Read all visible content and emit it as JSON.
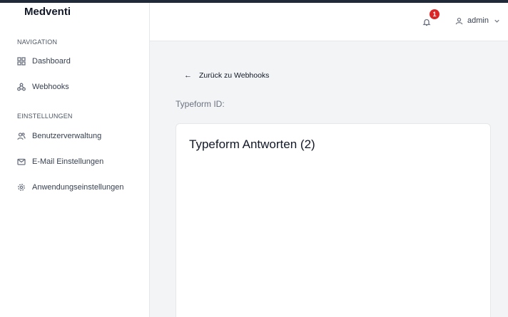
{
  "app": {
    "brand": "Medventi"
  },
  "sidebar": {
    "sections": [
      {
        "label": "NAVIGATION"
      },
      {
        "label": "EINSTELLUNGEN"
      }
    ],
    "items": [
      {
        "label": "Dashboard",
        "icon": "dashboard-icon"
      },
      {
        "label": "Webhooks",
        "icon": "webhook-icon"
      },
      {
        "label": "Benutzerverwaltung",
        "icon": "users-icon"
      },
      {
        "label": "E-Mail Einstellungen",
        "icon": "mail-icon"
      },
      {
        "label": "Anwendungseinstellungen",
        "icon": "gear-icon"
      }
    ]
  },
  "header": {
    "notification_count": "1",
    "user_name": "admin"
  },
  "main": {
    "back_label": "Zurück zu Webhooks",
    "typeform_id_label": "Typeform ID:",
    "card_title": "Typeform Antworten (2)"
  },
  "colors": {
    "badge": "#dc2626",
    "topbar": "#1f2937"
  }
}
